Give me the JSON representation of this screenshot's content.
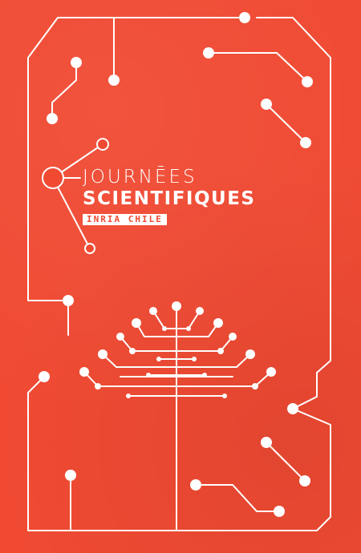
{
  "title": {
    "line1": "JOURNĒES",
    "line2": "SCIENTIFIQUES",
    "badge": "INRIA CHILE"
  },
  "colors": {
    "background": "#f04a33",
    "foreground": "#ffffff"
  },
  "icons": [
    "circuit-network-icon",
    "tree-circuit-icon"
  ]
}
